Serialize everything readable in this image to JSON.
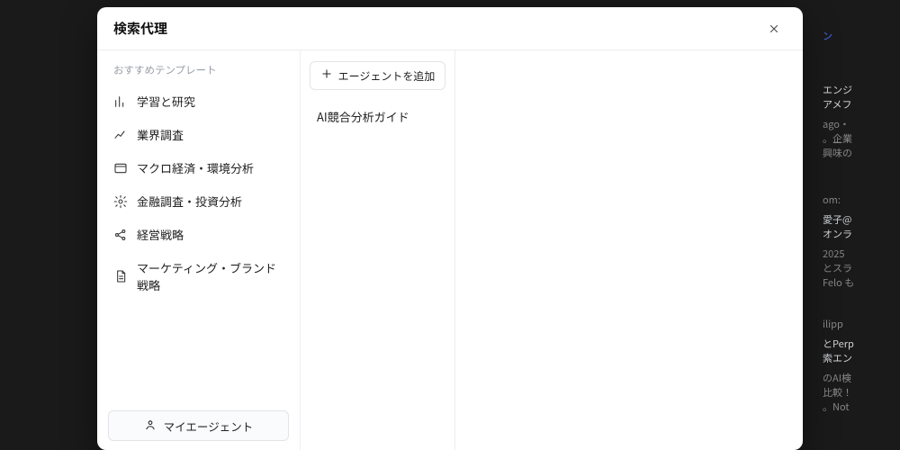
{
  "modal": {
    "title": "検索代理"
  },
  "sidebar": {
    "section_label": "おすすめテンプレート",
    "items": [
      {
        "label": "学習と研究"
      },
      {
        "label": "業界調査"
      },
      {
        "label": "マクロ経済・環境分析"
      },
      {
        "label": "金融調査・投資分析"
      },
      {
        "label": "経営戦略"
      },
      {
        "label": "マーケティング・ブランド戦略"
      }
    ],
    "my_agents_label": "マイエージェント"
  },
  "middle": {
    "add_agent_label": "エージェントを追加",
    "agents": [
      {
        "label": "AI競合分析ガイド"
      }
    ]
  },
  "background": {
    "card1_lines": [
      "ン",
      "エンジ",
      "アメフ",
      "ago・",
      "。企業",
      "興味の"
    ],
    "card2_lines": [
      "om:",
      "愛子@",
      "オンラ",
      "2025",
      "とスラ",
      "Felo も"
    ],
    "card3_lines": [
      "ilipp",
      "とPerp",
      "索エン",
      "のAI検",
      "比較！",
      "。Not"
    ]
  }
}
